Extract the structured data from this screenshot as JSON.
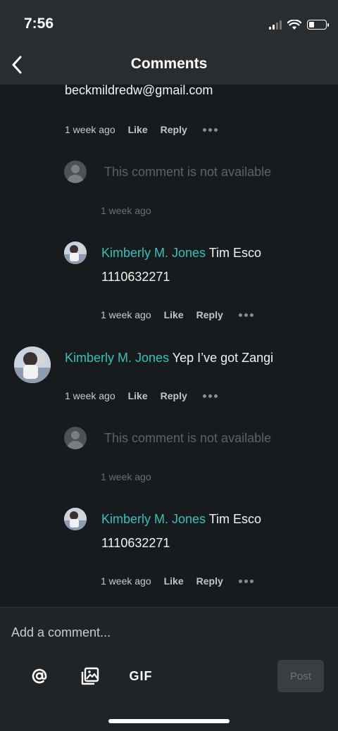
{
  "status_bar": {
    "time": "7:56"
  },
  "nav": {
    "title": "Comments"
  },
  "comments": [
    {
      "text": "beckmildredw@gmail.com",
      "timestamp": "1 week ago",
      "like_label": "Like",
      "reply_label": "Reply"
    },
    {
      "unavailable_text": "This comment is not available",
      "timestamp": "1 week ago"
    },
    {
      "author": "Kimberly M. Jones",
      "text_line1": " Tim Esco",
      "text_line2": "1110632271",
      "timestamp": "1 week ago",
      "like_label": "Like",
      "reply_label": "Reply"
    },
    {
      "author": "Kimberly M. Jones",
      "text_line1": " Yep I’ve got Zangi",
      "timestamp": "1 week ago",
      "like_label": "Like",
      "reply_label": "Reply"
    },
    {
      "unavailable_text": "This comment is not available",
      "timestamp": "1 week ago"
    },
    {
      "author": "Kimberly M. Jones",
      "text_line1": " Tim Esco",
      "text_line2": "1110632271",
      "timestamp": "1 week ago",
      "like_label": "Like",
      "reply_label": "Reply"
    }
  ],
  "composer": {
    "placeholder": "Add a comment...",
    "gif_label": "GIF",
    "post_label": "Post"
  },
  "icons": {
    "back": "chevron-left-icon",
    "mention": "at-sign-icon",
    "image": "image-gallery-icon",
    "more": "more-dots-icon",
    "default_avatar": "person-placeholder-icon"
  },
  "colors": {
    "author": "#34c3b6",
    "background": "#171b1e",
    "header": "#2a2d30"
  }
}
